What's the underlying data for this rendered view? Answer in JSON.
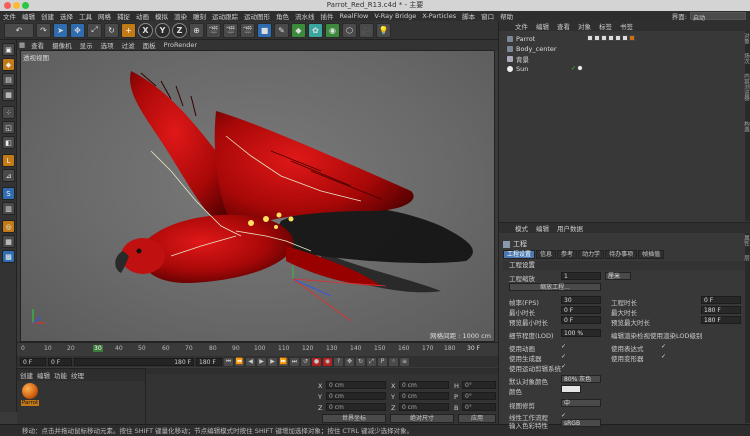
{
  "window": {
    "title": "Parrot_Red_R13.c4d * - 主要"
  },
  "menubar": {
    "items": [
      "文件",
      "编辑",
      "创建",
      "选择",
      "工具",
      "网格",
      "捕捉",
      "动画",
      "模拟",
      "渲染",
      "雕刻",
      "运动跟踪",
      "运动图形",
      "角色",
      "流水线",
      "插件",
      "RealFlow",
      "V-Ray Bridge",
      "X-Particles",
      "脚本",
      "窗口",
      "帮助"
    ],
    "interface_label": "界面:",
    "interface_value": "启动"
  },
  "toolbar": {
    "axis_labels": [
      "X",
      "Y",
      "Z"
    ]
  },
  "viewport": {
    "menu": [
      "查看",
      "摄像机",
      "显示",
      "选项",
      "过滤",
      "面板",
      "ProRender"
    ],
    "label": "透视视图",
    "grid_label": "网格间距 : 1000 cm",
    "accent": "#cc1010"
  },
  "timeline": {
    "ticks": [
      "0",
      "10",
      "20",
      "30",
      "40",
      "50",
      "60",
      "70",
      "80",
      "90",
      "100",
      "110",
      "120",
      "130",
      "140",
      "150",
      "160",
      "170",
      "180"
    ],
    "frame_end_marker": "30 F",
    "current_frame": "0 F",
    "start_frame": "0 F",
    "end_field": "180 F",
    "end_field_2": "180 F"
  },
  "material_panel": {
    "menu": [
      "创建",
      "编辑",
      "功能",
      "纹理"
    ],
    "material_name": "Parrot"
  },
  "coord_panel": {
    "rows": [
      {
        "axis": "X",
        "pos": "0 cm",
        "axis2": "X",
        "size": "0 cm",
        "rot_label": "H",
        "rot": "0°"
      },
      {
        "axis": "Y",
        "pos": "0 cm",
        "axis2": "Y",
        "size": "0 cm",
        "rot_label": "P",
        "rot": "0°"
      },
      {
        "axis": "Z",
        "pos": "0 cm",
        "axis2": "Z",
        "size": "0 cm",
        "rot_label": "B",
        "rot": "0°"
      }
    ],
    "mode1": "世界坐标",
    "mode2": "绝对尺寸",
    "apply": "应用"
  },
  "status": {
    "text": "移动：点击并拖动鼠标移动元素。按住 SHIFT 键量化移动；节点编辑模式时按住 SHIFT 键增加选择对象；按住 CTRL 键减少选择对象。"
  },
  "object_manager": {
    "menu": [
      "文件",
      "编辑",
      "查看",
      "对象",
      "标签",
      "书签"
    ],
    "objects": [
      {
        "name": "Parrot",
        "color": "#9aa0a6"
      },
      {
        "name": "Body_center",
        "color": "#9aa0a6"
      },
      {
        "name": "背景",
        "color": "#9aa0a6"
      },
      {
        "name": "Sun",
        "color": "#e0e0e0"
      }
    ]
  },
  "attribute_manager": {
    "menu": [
      "模式",
      "编辑",
      "用户数据"
    ],
    "title": "工程",
    "tabs": [
      "工程设置",
      "信息",
      "参考",
      "动力学",
      "待办事项",
      "帧插值"
    ],
    "section": "工程设置",
    "project_scale_label": "工程缩放",
    "project_scale_value": "1",
    "project_scale_unit": "厘米",
    "scale_button": "缩放工程...",
    "fps_label": "帧率(FPS)",
    "fps_value": "30",
    "project_time_label": "工程时长",
    "project_time_value": "0 F",
    "min_time_label": "最小时长",
    "min_time_value": "0 F",
    "max_time_label": "最大时长",
    "max_time_value": "180 F",
    "preview_min_label": "预览最小时长",
    "preview_min_value": "0 F",
    "preview_max_label": "预览最大时长",
    "preview_max_value": "180 F",
    "lod_label": "细节程度(LOD)",
    "lod_value": "100 %",
    "render_lod_label": "编辑渲染检视使用渲染LOD级别",
    "use_anim_label": "使用动画",
    "use_expr_label": "使用表达式",
    "use_gen_label": "使用生成器",
    "use_deform_label": "使用变形器",
    "use_motion_label": "使用运动剪辑系统",
    "default_color_label": "默认对象颜色",
    "default_color_value": "80% 灰色",
    "color_label": "颜色",
    "view_correct_label": "视图修剪",
    "view_correct_value": "中",
    "linear_wf_label": "线性工作流程",
    "input_color_label": "输入色彩特性",
    "input_color_value": "sRGB"
  }
}
